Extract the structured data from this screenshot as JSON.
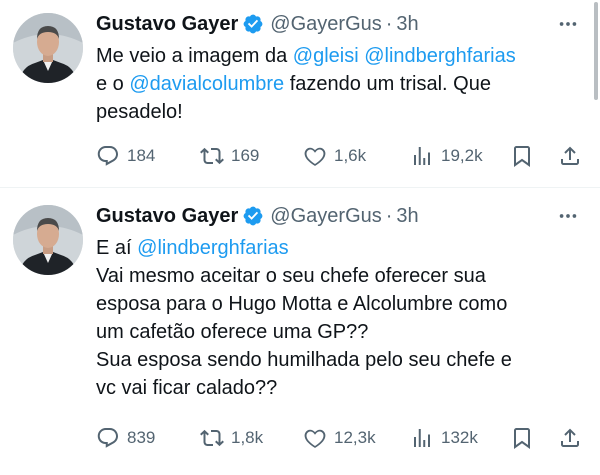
{
  "colors": {
    "accent": "#1d9bf0",
    "text": "#0f1419",
    "muted": "#536471",
    "divider": "#eff3f4"
  },
  "tweets": [
    {
      "author": {
        "name": "Gustavo Gayer",
        "handle": "@GayerGus",
        "separator": "·",
        "time": "3h",
        "avatar_icon": "profile-photo",
        "verified_icon": "verified-badge-icon"
      },
      "lines": [
        [
          {
            "text": "Me veio a imagem da ",
            "mention": false
          },
          {
            "text": "@gleisi",
            "mention": true
          },
          {
            "text": " ",
            "mention": false
          },
          {
            "text": "@lindberghfarias",
            "mention": true
          }
        ],
        [
          {
            "text": "e o ",
            "mention": false
          },
          {
            "text": "@davialcolumbre",
            "mention": true
          },
          {
            "text": " fazendo um trisal. Que",
            "mention": false
          }
        ],
        [
          {
            "text": "pesadelo!",
            "mention": false
          }
        ]
      ],
      "stats": {
        "replies": "184",
        "reposts": "169",
        "likes": "1,6k",
        "views": "19,2k"
      }
    },
    {
      "author": {
        "name": "Gustavo Gayer",
        "handle": "@GayerGus",
        "separator": "·",
        "time": "3h",
        "avatar_icon": "profile-photo",
        "verified_icon": "verified-badge-icon"
      },
      "lines": [
        [
          {
            "text": "E aí ",
            "mention": false
          },
          {
            "text": "@lindberghfarias",
            "mention": true
          }
        ],
        [
          {
            "text": "Vai mesmo aceitar o seu chefe oferecer sua",
            "mention": false
          }
        ],
        [
          {
            "text": "esposa para o Hugo Motta e Alcolumbre como",
            "mention": false
          }
        ],
        [
          {
            "text": "um cafetão oferece uma GP??",
            "mention": false
          }
        ],
        [
          {
            "text": "Sua esposa sendo humilhada pelo seu chefe e",
            "mention": false
          }
        ],
        [
          {
            "text": "vc vai ficar calado??",
            "mention": false
          }
        ]
      ],
      "stats": {
        "replies": "839",
        "reposts": "1,8k",
        "likes": "12,3k",
        "views": "132k"
      }
    }
  ]
}
